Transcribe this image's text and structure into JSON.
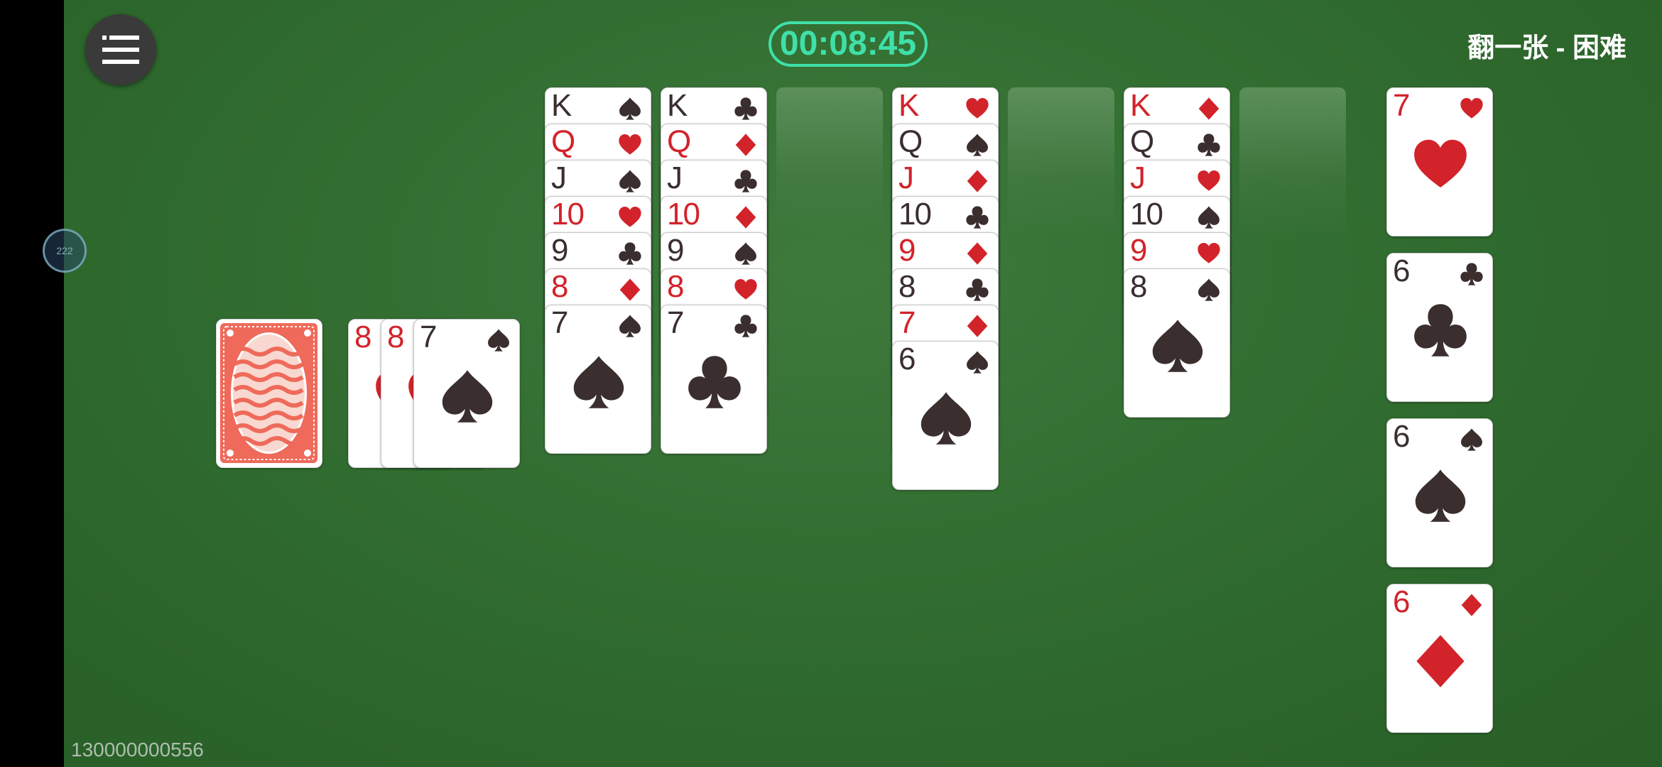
{
  "header": {
    "timer": "00:08:45",
    "mode": "翻一张 - 困难"
  },
  "footer": {
    "device_id": "130000000556"
  },
  "floating_ball": {
    "label": "222"
  },
  "colors": {
    "felt": "#2f6a2e",
    "timer": "#3fe0a8",
    "red_suit": "#d2232a",
    "black_suit": "#3a2e2e"
  },
  "stock": {
    "face_down": true
  },
  "waste": [
    {
      "rank": "8",
      "suit": "hearts"
    },
    {
      "rank": "8",
      "suit": "hearts"
    },
    {
      "rank": "7",
      "suit": "spades"
    }
  ],
  "tableau": [
    [
      {
        "rank": "K",
        "suit": "spades"
      },
      {
        "rank": "Q",
        "suit": "hearts"
      },
      {
        "rank": "J",
        "suit": "spades"
      },
      {
        "rank": "10",
        "suit": "hearts"
      },
      {
        "rank": "9",
        "suit": "clubs"
      },
      {
        "rank": "8",
        "suit": "diamonds"
      },
      {
        "rank": "7",
        "suit": "spades"
      }
    ],
    [
      {
        "rank": "K",
        "suit": "clubs"
      },
      {
        "rank": "Q",
        "suit": "diamonds"
      },
      {
        "rank": "J",
        "suit": "clubs"
      },
      {
        "rank": "10",
        "suit": "diamonds"
      },
      {
        "rank": "9",
        "suit": "spades"
      },
      {
        "rank": "8",
        "suit": "hearts"
      },
      {
        "rank": "7",
        "suit": "clubs"
      }
    ],
    [],
    [
      {
        "rank": "K",
        "suit": "hearts"
      },
      {
        "rank": "Q",
        "suit": "spades"
      },
      {
        "rank": "J",
        "suit": "diamonds"
      },
      {
        "rank": "10",
        "suit": "clubs"
      },
      {
        "rank": "9",
        "suit": "diamonds"
      },
      {
        "rank": "8",
        "suit": "clubs"
      },
      {
        "rank": "7",
        "suit": "diamonds"
      },
      {
        "rank": "6",
        "suit": "spades"
      }
    ],
    [],
    [
      {
        "rank": "K",
        "suit": "diamonds"
      },
      {
        "rank": "Q",
        "suit": "clubs"
      },
      {
        "rank": "J",
        "suit": "hearts"
      },
      {
        "rank": "10",
        "suit": "spades"
      },
      {
        "rank": "9",
        "suit": "hearts"
      },
      {
        "rank": "8",
        "suit": "spades"
      }
    ],
    []
  ],
  "foundations": [
    {
      "rank": "7",
      "suit": "hearts"
    },
    {
      "rank": "6",
      "suit": "clubs"
    },
    {
      "rank": "6",
      "suit": "spades"
    },
    {
      "rank": "6",
      "suit": "diamonds"
    }
  ]
}
